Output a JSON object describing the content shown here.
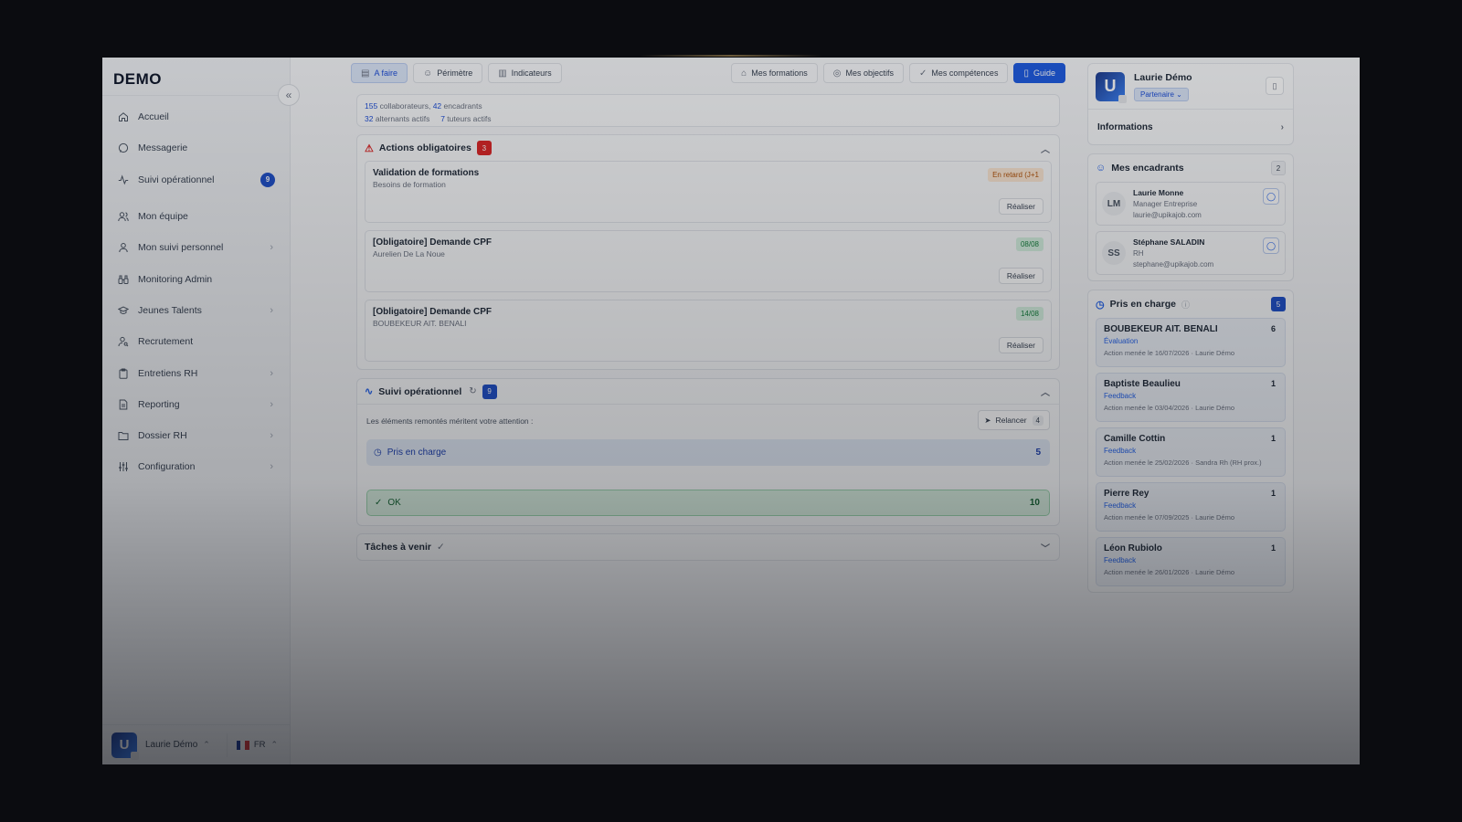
{
  "app": {
    "logo": "DEMO"
  },
  "sidebar": {
    "items": [
      {
        "label": "Accueil",
        "icon": "home-icon"
      },
      {
        "label": "Messagerie",
        "icon": "message-icon"
      },
      {
        "label": "Suivi opérationnel",
        "icon": "activity-icon",
        "badge": "9"
      },
      {
        "label": "Mon équipe",
        "icon": "team-icon"
      },
      {
        "label": "Mon suivi personnel",
        "icon": "user-icon",
        "chevron": true
      },
      {
        "label": "Monitoring Admin",
        "icon": "binoculars-icon"
      },
      {
        "label": "Jeunes Talents",
        "icon": "graduation-icon",
        "chevron": true
      },
      {
        "label": "Recrutement",
        "icon": "user-search-icon"
      },
      {
        "label": "Entretiens RH",
        "icon": "clipboard-icon",
        "chevron": true
      },
      {
        "label": "Reporting",
        "icon": "report-icon",
        "chevron": true
      },
      {
        "label": "Dossier RH",
        "icon": "folder-icon",
        "chevron": true
      },
      {
        "label": "Configuration",
        "icon": "sliders-icon",
        "chevron": true
      }
    ],
    "footer": {
      "avatar_letter": "U",
      "user_name": "Laurie Démo",
      "lang": "FR"
    }
  },
  "tabs": {
    "left": [
      {
        "label": "A faire",
        "icon": "list-icon"
      },
      {
        "label": "Périmètre",
        "icon": "users-icon"
      },
      {
        "label": "Indicateurs",
        "icon": "chart-icon"
      }
    ],
    "right": [
      {
        "label": "Mes formations",
        "icon": "graduation-icon"
      },
      {
        "label": "Mes objectifs",
        "icon": "target-icon"
      },
      {
        "label": "Mes compétences",
        "icon": "check-circle-icon"
      },
      {
        "label": "Guide",
        "icon": "book-icon"
      }
    ]
  },
  "stats": {
    "collab_count": "155",
    "collab_label": "collaborateurs,",
    "encadrants_count": "42",
    "encadrants_label": "encadrants",
    "alternants_count": "32",
    "alternants_label": "alternants actifs",
    "tuteurs_count": "7",
    "tuteurs_label": "tuteurs actifs"
  },
  "actions": {
    "title": "Actions obligatoires",
    "count": "3",
    "items": [
      {
        "title": "Validation de formations",
        "subtitle": "Besoins de formation",
        "status": "En retard (J+1",
        "button": "Réaliser"
      },
      {
        "title": "[Obligatoire] Demande CPF",
        "subtitle": "Aurelien De La Noue",
        "status": "08/08",
        "button": "Réaliser"
      },
      {
        "title": "[Obligatoire] Demande CPF",
        "subtitle": "BOUBEKEUR AIT. BENALI",
        "status": "14/08",
        "button": "Réaliser"
      }
    ]
  },
  "suivi": {
    "title": "Suivi opérationnel",
    "count": "9",
    "note": "Les éléments remontés méritent votre attention :",
    "relancer_label": "Relancer",
    "relancer_count": "4",
    "pris_label": "Pris en charge",
    "pris_count": "5",
    "ok_label": "OK",
    "ok_count": "10"
  },
  "taches": {
    "title": "Tâches à venir"
  },
  "profile": {
    "avatar_letter": "U",
    "name": "Laurie Démo",
    "role": "Partenaire",
    "info_label": "Informations"
  },
  "encadrants": {
    "title": "Mes encadrants",
    "count": "2",
    "people": [
      {
        "initials": "LM",
        "name": "Laurie Monne",
        "role": "Manager Entreprise",
        "email": "laurie@upikajob.com"
      },
      {
        "initials": "SS",
        "name": "Stéphane SALADIN",
        "role": "RH",
        "email": "stephane@upikajob.com"
      }
    ]
  },
  "pris_en_charge": {
    "title": "Pris en charge",
    "count": "5",
    "items": [
      {
        "name": "BOUBEKEUR AIT. BENALI",
        "count": "6",
        "type": "Évaluation",
        "detail": "Action menée le 16/07/2026 · Laurie Démo"
      },
      {
        "name": "Baptiste Beaulieu",
        "count": "1",
        "type": "Feedback",
        "detail": "Action menée le 03/04/2026 · Laurie Démo"
      },
      {
        "name": "Camille Cottin",
        "count": "1",
        "type": "Feedback",
        "detail": "Action menée le 25/02/2026 · Sandra Rh (RH prox.)"
      },
      {
        "name": "Pierre Rey",
        "count": "1",
        "type": "Feedback",
        "detail": "Action menée le 07/09/2025 · Laurie Démo"
      },
      {
        "name": "Léon Rubiolo",
        "count": "1",
        "type": "Feedback",
        "detail": "Action menée le 26/01/2026 · Laurie Démo"
      }
    ]
  }
}
